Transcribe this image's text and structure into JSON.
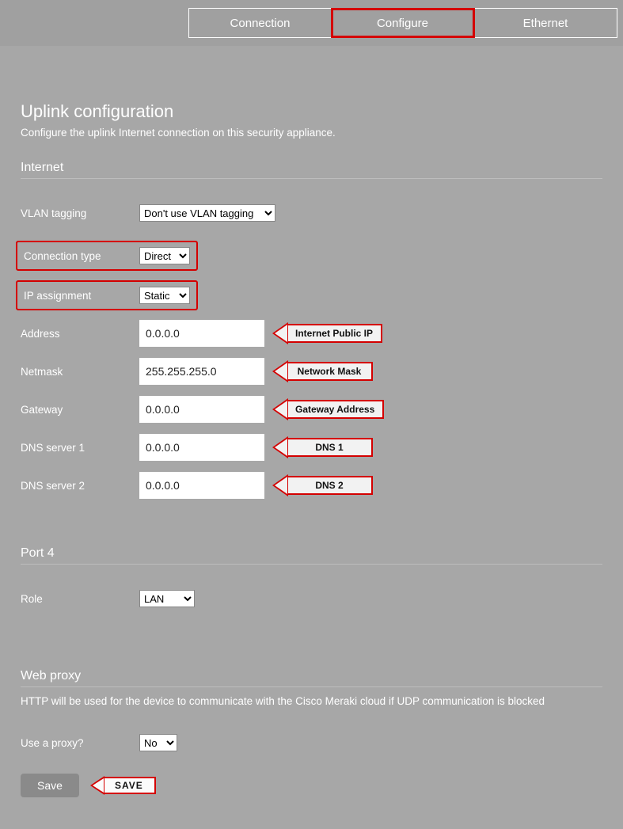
{
  "tabs": {
    "connection": "Connection",
    "configure": "Configure",
    "ethernet": "Ethernet"
  },
  "page": {
    "title": "Uplink configuration",
    "subtitle": "Configure the uplink Internet connection on this security appliance."
  },
  "internet": {
    "heading": "Internet",
    "vlan_label": "VLAN tagging",
    "vlan_value": "Don't use VLAN tagging",
    "conn_type_label": "Connection type",
    "conn_type_value": "Direct",
    "ip_assign_label": "IP assignment",
    "ip_assign_value": "Static",
    "address_label": "Address",
    "address_value": "0.0.0.0",
    "address_callout": "Internet Public IP",
    "netmask_label": "Netmask",
    "netmask_value": "255.255.255.0",
    "netmask_callout": "Network Mask",
    "gateway_label": "Gateway",
    "gateway_value": "0.0.0.0",
    "gateway_callout": "Gateway Address",
    "dns1_label": "DNS server 1",
    "dns1_value": "0.0.0.0",
    "dns1_callout": "DNS 1",
    "dns2_label": "DNS server 2",
    "dns2_value": "0.0.0.0",
    "dns2_callout": "DNS 2"
  },
  "port4": {
    "heading": "Port 4",
    "role_label": "Role",
    "role_value": "LAN"
  },
  "proxy": {
    "heading": "Web proxy",
    "desc": "HTTP will be used for the device to communicate with the Cisco Meraki cloud if UDP communication is blocked",
    "use_label": "Use a proxy?",
    "use_value": "No"
  },
  "save": {
    "button": "Save",
    "callout": "SAVE"
  }
}
